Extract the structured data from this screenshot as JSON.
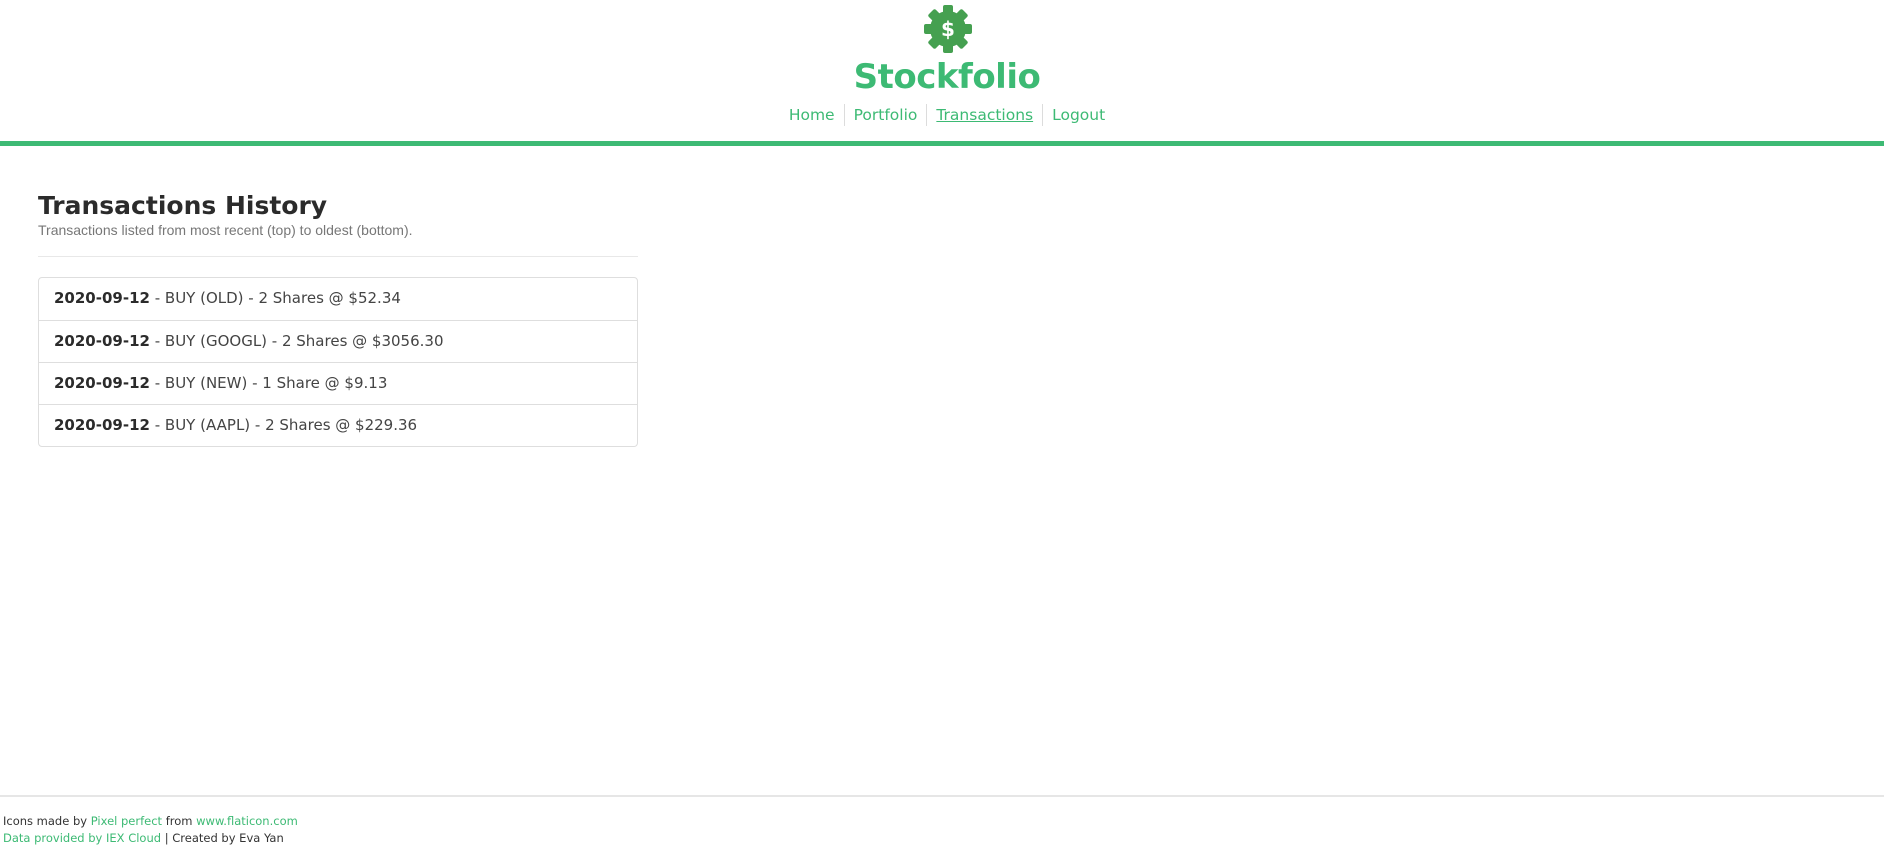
{
  "brand": {
    "title": "Stockfolio",
    "logo_icon": "gear-dollar-icon",
    "accent_color": "#3dba74"
  },
  "nav": {
    "items": [
      {
        "label": "Home"
      },
      {
        "label": "Portfolio"
      },
      {
        "label": "Transactions",
        "active": true
      },
      {
        "label": "Logout"
      }
    ]
  },
  "main": {
    "title": "Transactions History",
    "subtitle": "Transactions listed from most recent (top) to oldest (bottom).",
    "transactions": [
      {
        "date": "2020-09-12",
        "details": " - BUY (OLD) - 2 Shares @ $52.34"
      },
      {
        "date": "2020-09-12",
        "details": " - BUY (GOOGL) - 2 Shares @ $3056.30"
      },
      {
        "date": "2020-09-12",
        "details": " - BUY (NEW) - 1 Share @ $9.13"
      },
      {
        "date": "2020-09-12",
        "details": " - BUY (AAPL) - 2 Shares @ $229.36"
      }
    ]
  },
  "footer": {
    "line1_prefix": "Icons made by ",
    "line1_author": "Pixel perfect",
    "line1_middle": " from ",
    "line1_site": "www.flaticon.com",
    "line2_data": "Data provided by IEX Cloud",
    "line2_suffix": " | Created by Eva Yan"
  }
}
